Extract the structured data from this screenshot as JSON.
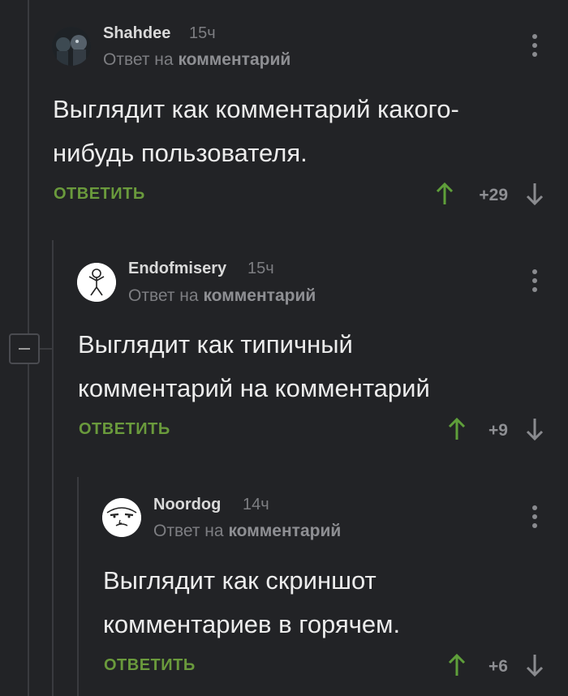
{
  "comments": [
    {
      "author": "Shahdee",
      "time": "15ч",
      "reply_prefix": "Ответ на",
      "reply_target": "комментарий",
      "text_line1": "Выглядит как комментарий какого-",
      "text_line2": "нибудь пользователя.",
      "reply_label": "ОТВЕТИТЬ",
      "score": "+29"
    },
    {
      "author": "Endofmisery",
      "time": "15ч",
      "reply_prefix": "Ответ на",
      "reply_target": "комментарий",
      "text_line1": "Выглядит как типичный",
      "text_line2": "комментарий на комментарий",
      "reply_label": "ОТВЕТИТЬ",
      "score": "+9"
    },
    {
      "author": "Noordog",
      "time": "14ч",
      "reply_prefix": "Ответ на",
      "reply_target": "комментарий",
      "text_line1": "Выглядит как скриншот",
      "text_line2": "комментариев в горячем.",
      "reply_label": "ОТВЕТИТЬ",
      "score": "+6"
    }
  ],
  "colors": {
    "background": "#222326",
    "reply_green": "#6a9a3c",
    "upvote_green": "#5f9f3a",
    "muted": "#7d7e82"
  },
  "icons": [
    "avatar",
    "more-vertical-icon",
    "arrow-up-icon",
    "arrow-down-icon",
    "collapse-minus-icon"
  ]
}
